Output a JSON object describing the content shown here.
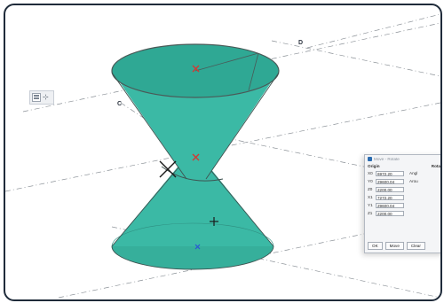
{
  "scene": {
    "labels": {
      "c": "C",
      "d": "D"
    },
    "colors": {
      "surface": "#3bb9a5",
      "surface_top": "#2fa894",
      "edge": "#4a5a58",
      "marker_red": "#d23a34",
      "marker_blue": "#2a55d6"
    }
  },
  "toolbar": {
    "icon": "list-icon",
    "glyph": "⊹"
  },
  "dialog": {
    "title": "Move - Rotate",
    "origin_header": "Origin",
    "rotation_header": "Rota",
    "fields": [
      {
        "label": "X0",
        "value": "6972.20"
      },
      {
        "label": "Y0",
        "value": "29600.04"
      },
      {
        "label": "Z0",
        "value": "2200.00"
      },
      {
        "label": "X1",
        "value": "7272.20"
      },
      {
        "label": "Y1",
        "value": "29600.04"
      },
      {
        "label": "Z1",
        "value": "2200.00"
      }
    ],
    "rotation_labels": [
      "Angl",
      "Arou"
    ],
    "buttons": {
      "ok": "OK",
      "move": "Move",
      "clear": "Clear"
    }
  }
}
